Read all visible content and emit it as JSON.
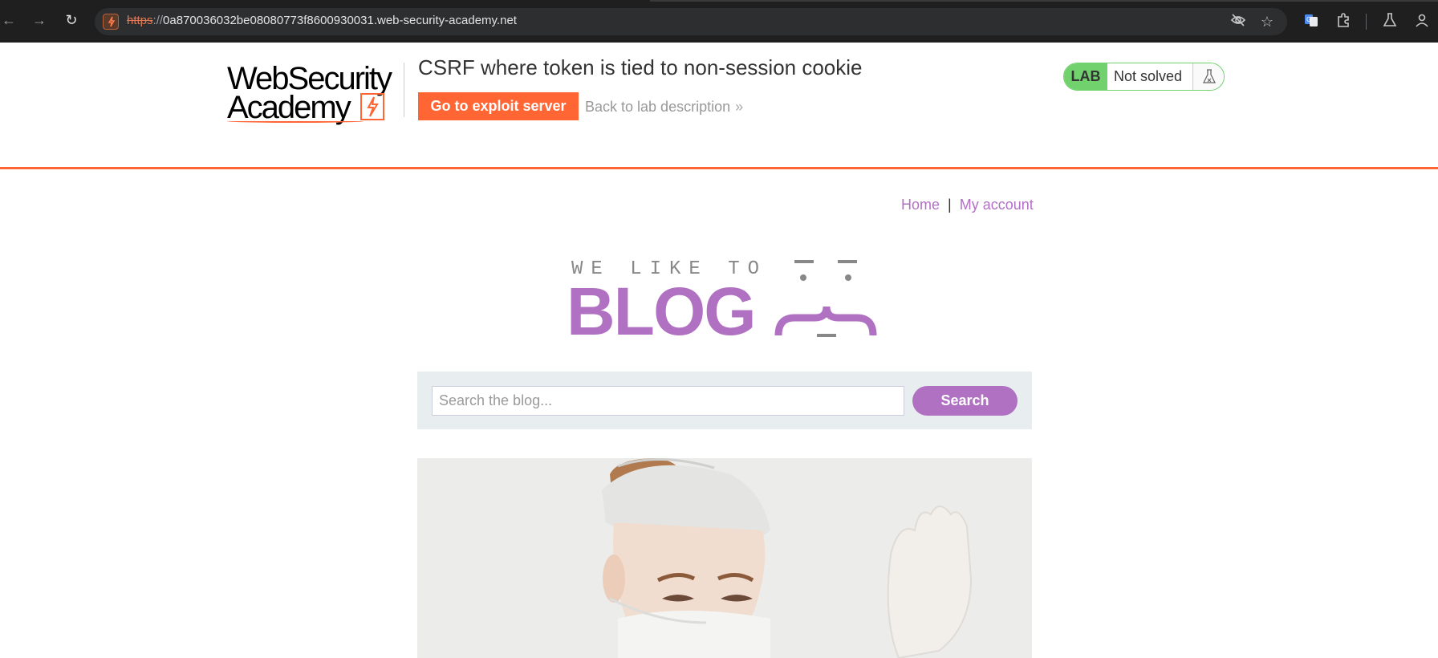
{
  "browser": {
    "url_scheme": "https",
    "url_separator": "://",
    "url_host": "0a870036032be08080773f8600930031.web-security-academy.net",
    "icons": [
      "back-icon",
      "forward-icon",
      "reload-icon",
      "site-info-icon",
      "eye-off-icon",
      "star-icon",
      "translate-icon",
      "extensions-icon",
      "labs-icon",
      "profile-icon"
    ]
  },
  "lab": {
    "logo_line1": "WebSecurity",
    "logo_line2": "Academy",
    "title": "CSRF where token is tied to non-session cookie",
    "exploit_button": "Go to exploit server",
    "back_link": "Back to lab description",
    "back_chevron": "»",
    "status_tag": "LAB",
    "status_text": "Not solved",
    "accent_color": "#ff6633",
    "status_color": "#70d16d"
  },
  "site_nav": {
    "home": "Home",
    "separator": "|",
    "my_account": "My account"
  },
  "banner": {
    "tagline": "WE LIKE TO",
    "big": "BLOG"
  },
  "search": {
    "placeholder": "Search the blog...",
    "button": "Search",
    "accent_color": "#b071c3"
  },
  "post": {
    "image_subject": "surgeon in mask and cap holding gloved hand up"
  }
}
